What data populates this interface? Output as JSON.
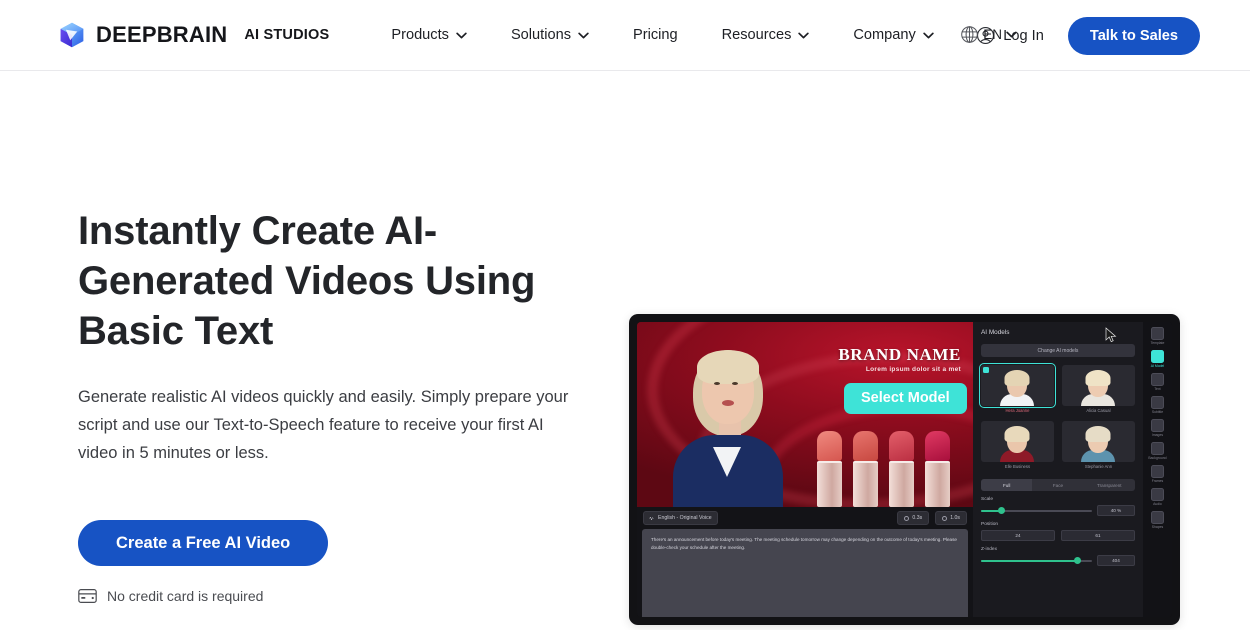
{
  "header": {
    "logo": {
      "icon": "cube-logo-icon",
      "brand": "DEEPBRAIN",
      "product": "AI STUDIOS"
    },
    "nav": [
      {
        "label": "Products",
        "caret": "chevron-down-icon"
      },
      {
        "label": "Solutions",
        "caret": "chevron-down-icon"
      },
      {
        "label": "Pricing",
        "caret": ""
      },
      {
        "label": "Resources",
        "caret": "chevron-down-icon"
      },
      {
        "label": "Company",
        "caret": "chevron-down-icon"
      }
    ],
    "language": {
      "icon": "globe-icon",
      "label": "EN",
      "caret": "chevron-down-icon"
    },
    "login": {
      "icon": "user-circle-icon",
      "label": "Log In"
    },
    "cta": "Talk to Sales"
  },
  "hero": {
    "headline": "Instantly Create AI-Generated Videos Using Basic Text",
    "subtext": "Generate realistic AI videos quickly and easily. Simply prepare your script and use our Text-to-Speech feature to receive your first AI video in 5 minutes or less.",
    "cta": "Create a Free AI Video",
    "note": {
      "icon": "credit-card-icon",
      "label": "No credit card is required"
    }
  },
  "editor": {
    "stage": {
      "brand_title": "BRAND NAME",
      "brand_subtitle": "Lorem ipsum dolor sit a met",
      "voice_chip": {
        "icon": "voice-waveform-icon",
        "label": "English - Original Voice"
      },
      "time_chips": [
        {
          "icon": "clock-icon",
          "label": "0.3s"
        },
        {
          "icon": "clock-icon",
          "label": "1.0s"
        }
      ],
      "script": "There's an announcement before today's meeting. The meeting schedule tomorrow may change depending on the outcome of today's meeting. Please double-check your schedule after the meeting.",
      "select_model_button": "Select Model"
    },
    "panel": {
      "title": "AI Models",
      "change_button": "Change AI models",
      "models": [
        {
          "label": "Hera Joanne",
          "selected": true
        },
        {
          "label": "Alicia Casual",
          "selected": false
        },
        {
          "label": "Elle Business",
          "selected": false
        },
        {
          "label": "Stephanie Ann",
          "selected": false
        }
      ],
      "tabs": [
        {
          "label": "Full",
          "active": true
        },
        {
          "label": "Face",
          "active": false
        },
        {
          "label": "Transparent",
          "active": false
        }
      ],
      "controls": [
        {
          "name": "Scale",
          "value": "40 %"
        },
        {
          "name": "Position",
          "x": "24",
          "y": "61"
        },
        {
          "name": "Z-index",
          "value": "404"
        }
      ]
    },
    "rail": [
      {
        "label": "Template",
        "active": false
      },
      {
        "label": "AI Model",
        "active": true
      },
      {
        "label": "Text",
        "active": false
      },
      {
        "label": "Subtitle",
        "active": false
      },
      {
        "label": "Images",
        "active": false
      },
      {
        "label": "Background",
        "active": false
      },
      {
        "label": "Frames",
        "active": false
      },
      {
        "label": "Audio",
        "active": false
      },
      {
        "label": "Shapes",
        "active": false
      }
    ],
    "cursor": "mouse-pointer-icon"
  },
  "colors": {
    "brand_blue": "#1753c4",
    "accent_teal": "#3ee3d7",
    "text_dark": "#232529"
  }
}
